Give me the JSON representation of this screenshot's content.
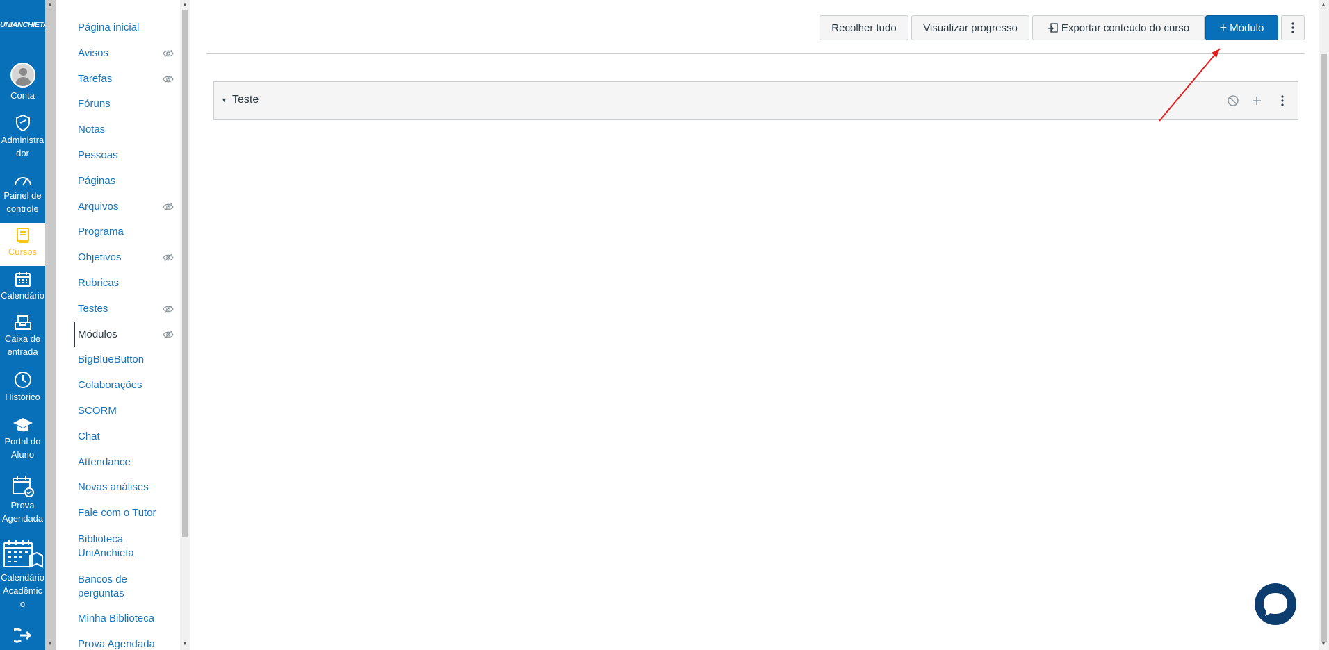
{
  "global_nav": {
    "logo": "UNIANCHIETA",
    "items": [
      {
        "label": "Conta"
      },
      {
        "label": "Administra dor"
      },
      {
        "label": "Painel de controle"
      },
      {
        "label": "Cursos"
      },
      {
        "label": "Calendário"
      },
      {
        "label": "Caixa de entrada"
      },
      {
        "label": "Histórico"
      },
      {
        "label": "Portal do Aluno"
      },
      {
        "label": "Prova Agendada"
      },
      {
        "label": "Calendário Acadêmic o"
      }
    ],
    "active_color": "#f5c518",
    "bg_color": "#0770b9"
  },
  "course_nav": {
    "items": [
      {
        "label": "Página inicial"
      },
      {
        "label": "Avisos",
        "hidden_icon": "eye-off-icon"
      },
      {
        "label": "Tarefas",
        "hidden_icon": "eye-off-icon"
      },
      {
        "label": "Fóruns"
      },
      {
        "label": "Notas"
      },
      {
        "label": "Pessoas"
      },
      {
        "label": "Páginas"
      },
      {
        "label": "Arquivos",
        "hidden_icon": "eye-off-icon"
      },
      {
        "label": "Programa"
      },
      {
        "label": "Objetivos",
        "hidden_icon": "eye-off-icon"
      },
      {
        "label": "Rubricas"
      },
      {
        "label": "Testes",
        "hidden_icon": "eye-off-icon"
      },
      {
        "label": "Módulos",
        "hidden_icon": "eye-off-icon",
        "active": true
      },
      {
        "label": "BigBlueButton"
      },
      {
        "label": "Colaborações"
      },
      {
        "label": "SCORM"
      },
      {
        "label": "Chat"
      },
      {
        "label": "Attendance"
      },
      {
        "label": "Novas análises"
      },
      {
        "label": "Fale com o Tutor"
      },
      {
        "label": "Biblioteca UniAnchieta"
      },
      {
        "label": "Bancos de perguntas"
      },
      {
        "label": "Minha Biblioteca"
      },
      {
        "label": "Prova Agendada"
      }
    ]
  },
  "toolbar": {
    "collapse_label": "Recolher tudo",
    "progress_label": "Visualizar progresso",
    "export_label": "Exportar conteúdo do curso",
    "add_module_label": "Módulo",
    "more_icon": "kebab-icon"
  },
  "module": {
    "title": "Teste",
    "controls": [
      "unpublished-icon",
      "add-item-icon",
      "kebab-icon"
    ]
  },
  "annotation": {
    "arrow_color": "#e02020"
  },
  "chat_widget": {
    "color": "#0d3d6e",
    "icon": "chat-bubble-icon"
  }
}
